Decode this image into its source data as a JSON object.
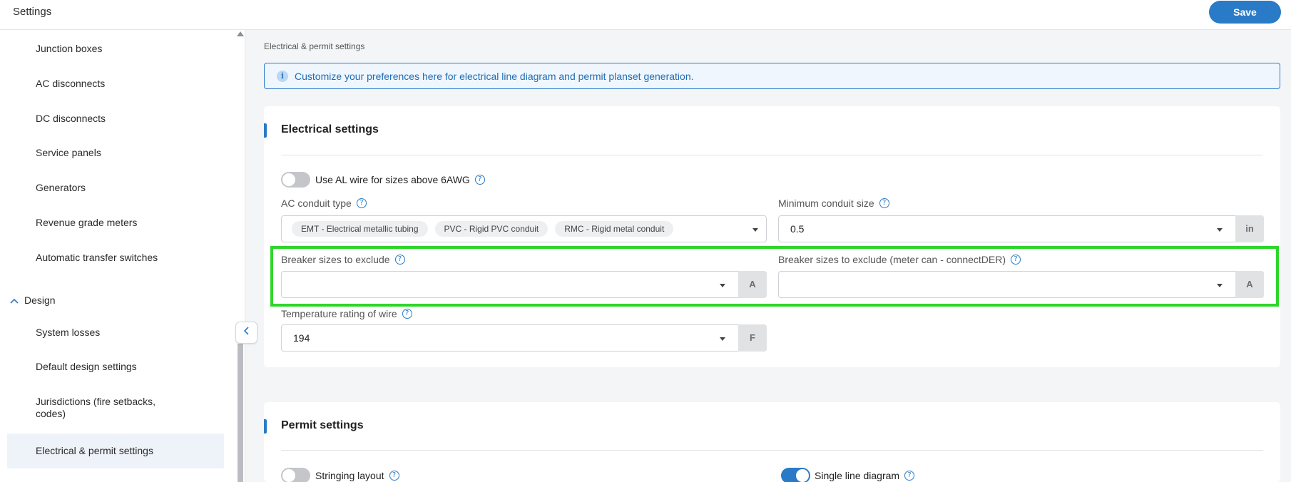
{
  "header": {
    "title": "Settings",
    "save_label": "Save"
  },
  "sidebar": {
    "items": [
      {
        "label": "Junction boxes"
      },
      {
        "label": "AC disconnects"
      },
      {
        "label": "DC disconnects"
      },
      {
        "label": "Service panels"
      },
      {
        "label": "Generators"
      },
      {
        "label": "Revenue grade meters"
      },
      {
        "label": "Automatic transfer switches"
      }
    ],
    "group": {
      "label": "Design",
      "expanded": true
    },
    "design_items": [
      {
        "label": "System losses"
      },
      {
        "label": "Default design settings"
      },
      {
        "label": "Jurisdictions (fire setbacks, codes)"
      },
      {
        "label": "Electrical & permit settings",
        "active": true
      }
    ]
  },
  "breadcrumb": "Electrical & permit settings",
  "info_banner": {
    "text": "Customize your preferences here for electrical line diagram and permit planset generation.",
    "icon": "info-icon"
  },
  "electrical": {
    "title": "Electrical settings",
    "al_wire_toggle": {
      "label": "Use AL wire for sizes above 6AWG",
      "on": false
    },
    "ac_conduit": {
      "label": "AC conduit type",
      "chips": [
        "EMT - Electrical metallic tubing",
        "PVC - Rigid PVC conduit",
        "RMC - Rigid metal conduit"
      ]
    },
    "min_conduit": {
      "label": "Minimum conduit size",
      "value": "0.5",
      "unit": "in"
    },
    "breaker_exclude": {
      "label": "Breaker sizes to exclude",
      "value": "",
      "unit": "A"
    },
    "breaker_exclude_meter": {
      "label": "Breaker sizes to exclude (meter can - connectDER)",
      "value": "",
      "unit": "A"
    },
    "temp_rating": {
      "label": "Temperature rating of wire",
      "value": "194",
      "unit": "F"
    }
  },
  "permit": {
    "title": "Permit settings",
    "stringing_toggle": {
      "label": "Stringing layout",
      "on": false
    },
    "single_line_toggle": {
      "label": "Single line diagram",
      "on": true
    }
  },
  "colors": {
    "accent": "#2a7bc7",
    "highlight": "#2ed62a"
  }
}
